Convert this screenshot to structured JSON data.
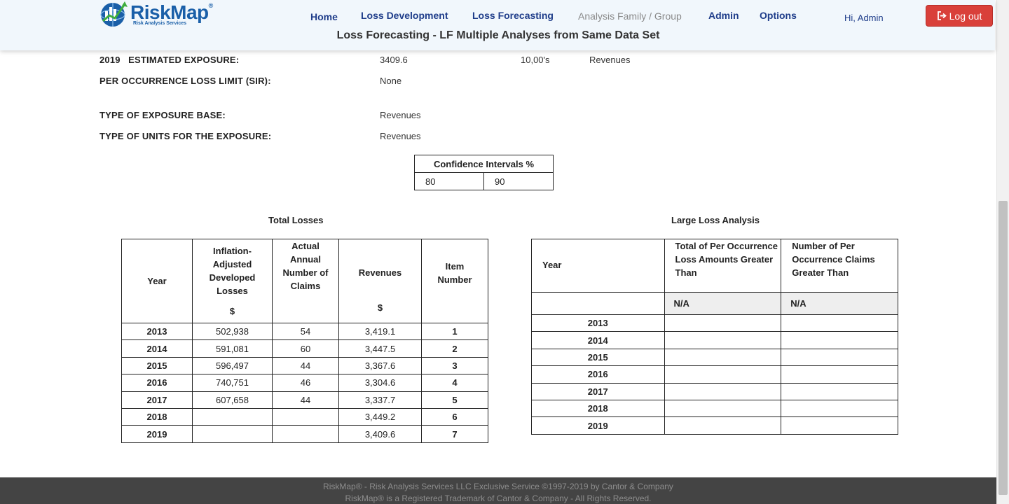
{
  "brand": {
    "name": "RiskMap",
    "reg_mark": "®",
    "tagline": "Risk Analysis Services"
  },
  "nav": {
    "items": [
      {
        "label": "Home"
      },
      {
        "label": "Loss Development"
      },
      {
        "label": "Loss Forecasting"
      },
      {
        "label": "Analysis Family / Group"
      },
      {
        "label": "Admin"
      },
      {
        "label": "Options"
      }
    ],
    "greeting": "Hi, Admin",
    "logout_label": "Log out"
  },
  "page_title": "Loss Forecasting - LF Multiple Analyses from Same Data Set",
  "info": {
    "exposure_year": "2019",
    "exposure_label": "ESTIMATED EXPOSURE:",
    "exposure_value": "3409.6",
    "exposure_unit": "10,00's",
    "exposure_type": "Revenues",
    "sir_label": "PER OCCURRENCE LOSS LIMIT (SIR):",
    "sir_value": "None",
    "base_label": "TYPE OF EXPOSURE BASE:",
    "base_value": "Revenues",
    "units_label": "TYPE OF UNITS FOR THE EXPOSURE:",
    "units_value": "Revenues"
  },
  "confidence": {
    "header": "Confidence Intervals %",
    "values": [
      "80",
      "90"
    ]
  },
  "total_losses": {
    "title": "Total Losses",
    "headers": {
      "year": "Year",
      "losses": "Inflation-Adjusted Developed Losses",
      "losses_unit": "$",
      "claims": "Actual Annual Number of Claims",
      "revenues": "Revenues",
      "revenues_unit": "$",
      "item": "Item Number"
    },
    "rows": [
      {
        "year": "2013",
        "losses": "502,938",
        "claims": "54",
        "revenues": "3,419.1",
        "item": "1"
      },
      {
        "year": "2014",
        "losses": "591,081",
        "claims": "60",
        "revenues": "3,447.5",
        "item": "2"
      },
      {
        "year": "2015",
        "losses": "596,497",
        "claims": "44",
        "revenues": "3,367.6",
        "item": "3"
      },
      {
        "year": "2016",
        "losses": "740,751",
        "claims": "46",
        "revenues": "3,304.6",
        "item": "4"
      },
      {
        "year": "2017",
        "losses": "607,658",
        "claims": "44",
        "revenues": "3,337.7",
        "item": "5"
      },
      {
        "year": "2018",
        "losses": "",
        "claims": "",
        "revenues": "3,449.2",
        "item": "6"
      },
      {
        "year": "2019",
        "losses": "",
        "claims": "",
        "revenues": "3,409.6",
        "item": "7"
      }
    ]
  },
  "large_loss": {
    "title": "Large Loss Analysis",
    "headers": {
      "year": "Year",
      "total": "Total of Per Occurrence Loss Amounts Greater Than",
      "number": "Number of Per Occurrence Claims Greater Than"
    },
    "threshold_total": "N/A",
    "threshold_number": "N/A",
    "years": [
      "2013",
      "2014",
      "2015",
      "2016",
      "2017",
      "2018",
      "2019"
    ]
  },
  "footer": {
    "line1": "RiskMap® - Risk Analysis Services LLC Exclusive Service ©1997-2019 by Cantor & Company",
    "line2": "RiskMap® is a Registered Trademark of Cantor & Company - All Rights Reserved."
  }
}
